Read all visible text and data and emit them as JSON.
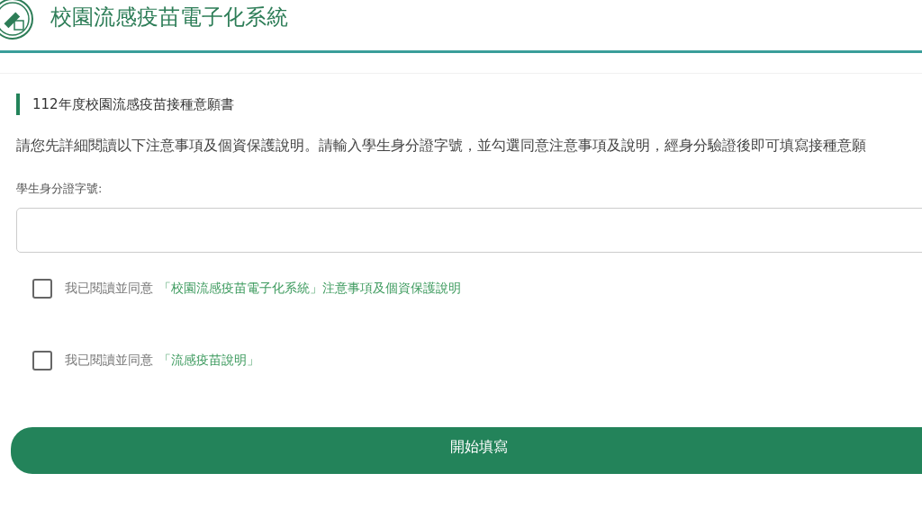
{
  "header": {
    "title": "校園流感疫苗電子化系統"
  },
  "section": {
    "heading": "112年度校園流感疫苗接種意願書",
    "instructions": "請您先詳細閱讀以下注意事項及個資保護說明。請輸入學生身分證字號，並勾選同意注意事項及說明，經身分驗證後即可填寫接種意願",
    "id_field": {
      "label": "學生身分證字號:"
    },
    "agreements": [
      {
        "prefix": "我已閱讀並同意",
        "link": "「校園流感疫苗電子化系統」注意事項及個資保護說明",
        "checked": false
      },
      {
        "prefix": "我已閱讀並同意",
        "link": "「流感疫苗說明」",
        "checked": false
      }
    ],
    "submit": "開始填寫"
  }
}
